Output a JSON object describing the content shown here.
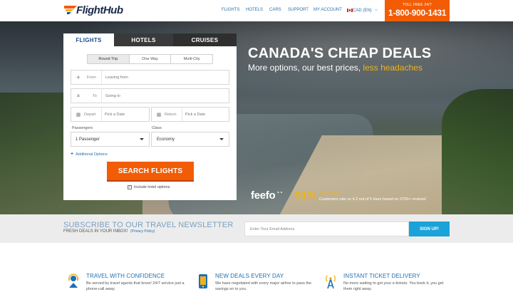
{
  "header": {
    "logo": "FlightHub",
    "nav": [
      "FLIGHTS",
      "HOTELS",
      "CARS",
      "SUPPORT",
      "MY ACCOUNT"
    ],
    "currency": "CAD (EN)",
    "tollfree_label": "TOLL FREE 24/7",
    "phone": "1-800-900-1431"
  },
  "search": {
    "tabs": [
      "FLIGHTS",
      "HOTELS",
      "CRUISES"
    ],
    "trip_types": [
      "Round Trip",
      "One Way",
      "Multi-City"
    ],
    "from_label": "From",
    "from_placeholder": "Leaving from",
    "to_label": "To",
    "to_placeholder": "Going to",
    "depart_label": "Depart",
    "depart_placeholder": "Pick a Date",
    "return_label": "Return",
    "return_placeholder": "Pick a Date",
    "passengers_label": "Passengers",
    "passengers_value": "1 Passenger",
    "class_label": "Class",
    "class_value": "Economy",
    "additional_options": "Additional Options",
    "search_button": "SEARCH FLIGHTS",
    "include_hotel": "Include hotel options"
  },
  "hero": {
    "title": "CANADA'S CHEAP DEALS",
    "subtitle_main": "More options, our best prices,",
    "subtitle_highlight": "less headaches",
    "feefo": "feefo",
    "percent": "91%",
    "stars": "★★★★★",
    "rating_text": "Customers rate us 4.2 out of 5 stars based on 3700+ reviews!"
  },
  "newsletter": {
    "title": "SUBSCRIBE TO OUR TRAVEL NEWSLETTER",
    "subtitle": "FRESH DEALS IN YOUR INBOX!",
    "privacy": "(Privacy Policy)",
    "email_placeholder": "Enter Your Email Address",
    "signup_button": "SIGN UP!"
  },
  "features": [
    {
      "title": "TRAVEL WITH CONFIDENCE",
      "desc": "Be served by travel agents that know! 24/7 service just a phone-call away."
    },
    {
      "title": "NEW DEALS EVERY DAY",
      "desc": "We have negotiated with every major airline to pass the savings on to you."
    },
    {
      "title": "INSTANT TICKET DELIVERY",
      "desc": "No more waiting to get your e-tickets. You book it, you get them right away."
    }
  ],
  "colors": {
    "orange": "#f25c05",
    "blue": "#1e6fb5",
    "gold": "#f0b21a",
    "signup": "#1aa3d9"
  }
}
